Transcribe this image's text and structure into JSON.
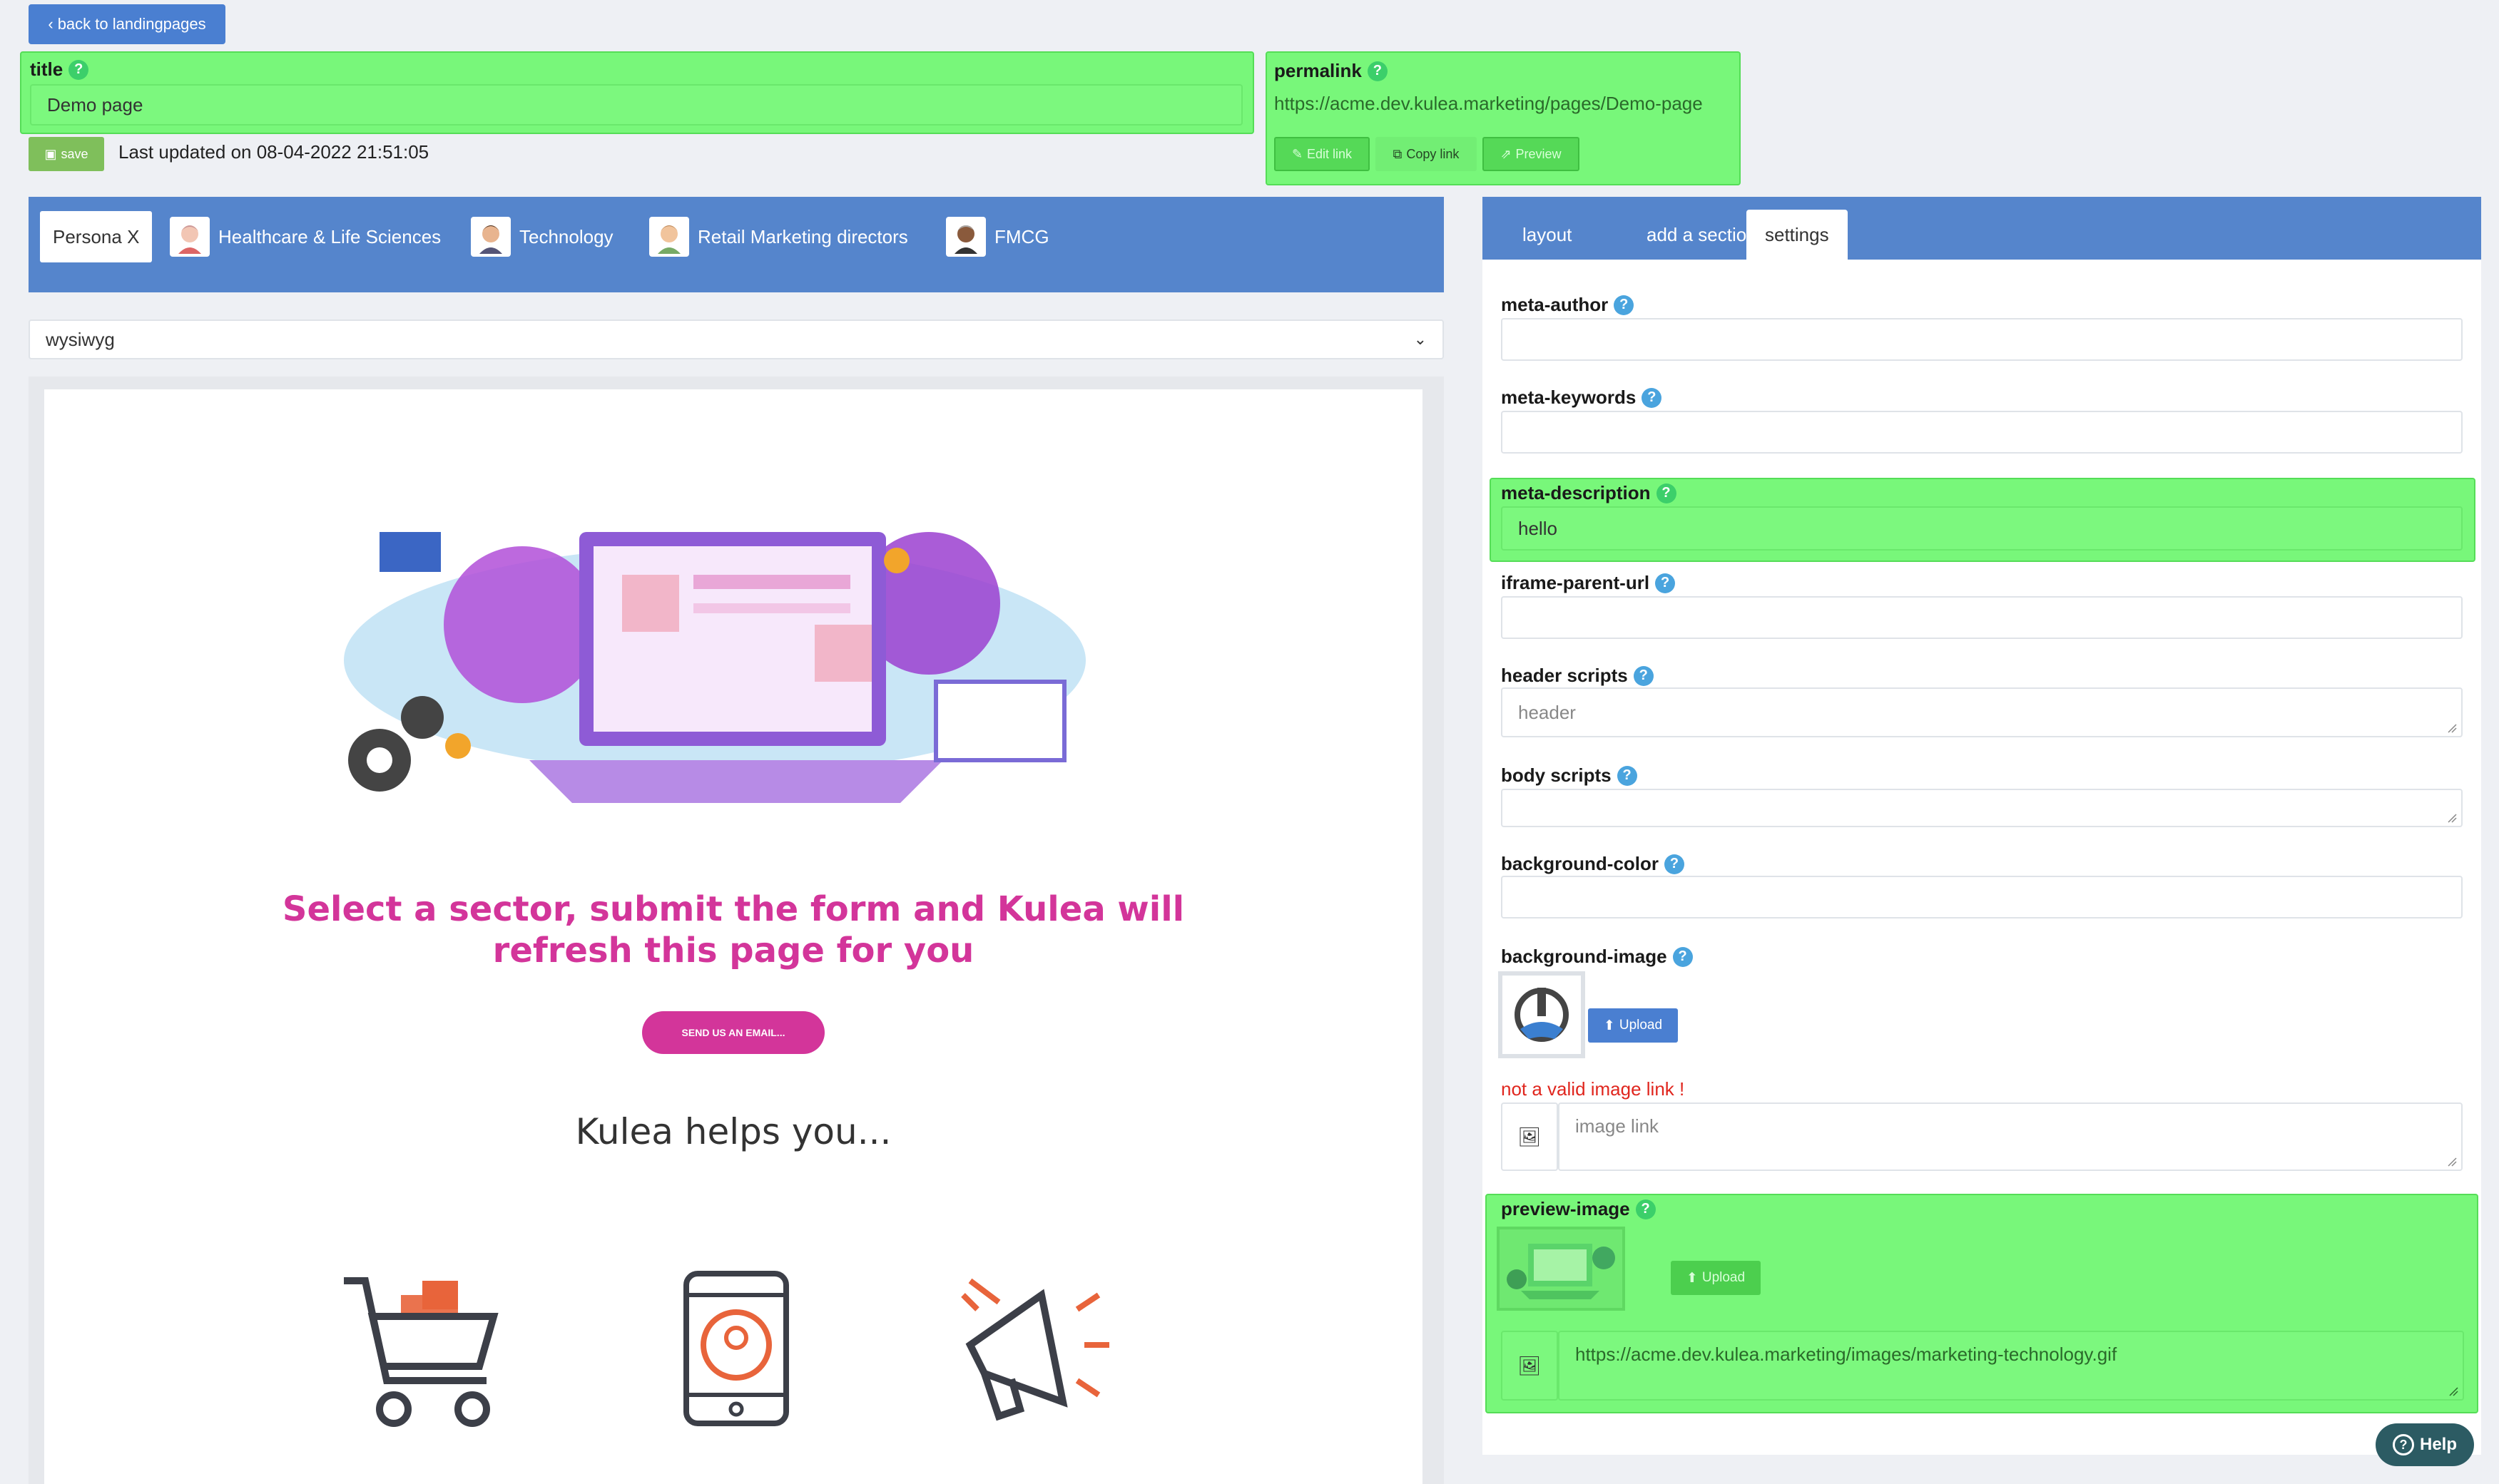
{
  "top": {
    "back_label": "back to landingpages",
    "title_label": "title",
    "title_value": "Demo page",
    "save_label": "save",
    "last_updated": "Last updated on 08-04-2022 21:51:05",
    "permalink_label": "permalink",
    "permalink_value": "https://acme.dev.kulea.marketing/pages/Demo-page",
    "edit_link_label": "Edit link",
    "copy_link_label": "Copy link",
    "preview_label": "Preview"
  },
  "personas": [
    {
      "label": "Persona X"
    },
    {
      "label": "Healthcare & Life Sciences"
    },
    {
      "label": "Technology"
    },
    {
      "label": "Retail Marketing directors"
    },
    {
      "label": "FMCG"
    }
  ],
  "editor_mode": "wysiwyg",
  "tabs": {
    "layout": "layout",
    "add_section": "add a section",
    "settings": "settings"
  },
  "settings": {
    "meta_author_label": "meta-author",
    "meta_author_value": "",
    "meta_keywords_label": "meta-keywords",
    "meta_keywords_value": "",
    "meta_description_label": "meta-description",
    "meta_description_value": "hello",
    "iframe_parent_label": "iframe-parent-url",
    "iframe_parent_value": "",
    "header_scripts_label": "header scripts",
    "header_scripts_placeholder": "header",
    "body_scripts_label": "body scripts",
    "background_color_label": "background-color",
    "background_image_label": "background-image",
    "upload_label": "Upload",
    "invalid_image_msg": "not a valid image link !",
    "image_link_placeholder": "image link",
    "preview_image_label": "preview-image",
    "preview_upload_label": "Upload",
    "preview_image_value": "https://acme.dev.kulea.marketing/images/marketing-technology.gif"
  },
  "preview": {
    "headline_line1": "Select a sector, submit the form and Kulea will",
    "headline_line2": "refresh this page for you",
    "cta_label": "SEND US AN EMAIL...",
    "subhead": "Kulea helps you..."
  },
  "help_label": "Help"
}
